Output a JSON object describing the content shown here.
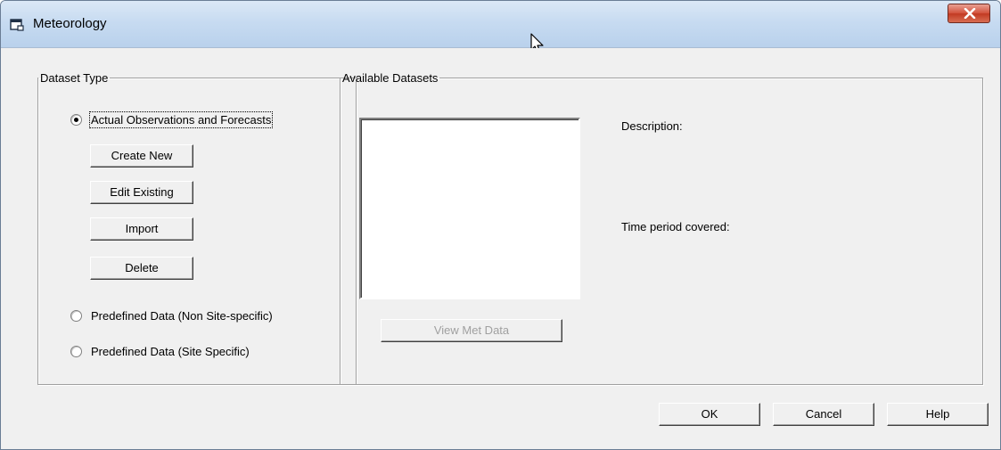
{
  "window": {
    "title": "Meteorology",
    "icon": "window-app-icon",
    "close_icon": "close-x-icon"
  },
  "dataset_type": {
    "legend": "Dataset Type",
    "options": [
      {
        "label": "Actual Observations and Forecasts",
        "selected": true
      },
      {
        "label": "Predefined Data (Non Site-specific)",
        "selected": false
      },
      {
        "label": "Predefined Data (Site Specific)",
        "selected": false
      }
    ],
    "buttons": {
      "create_new": "Create New",
      "edit_existing": "Edit Existing",
      "import": "Import",
      "delete": "Delete"
    }
  },
  "available": {
    "legend": "Available Datasets",
    "view_button": "View Met Data",
    "view_button_enabled": false,
    "description_label": "Description:",
    "time_period_label": "Time period covered:"
  },
  "footer": {
    "ok": "OK",
    "cancel": "Cancel",
    "help": "Help"
  }
}
